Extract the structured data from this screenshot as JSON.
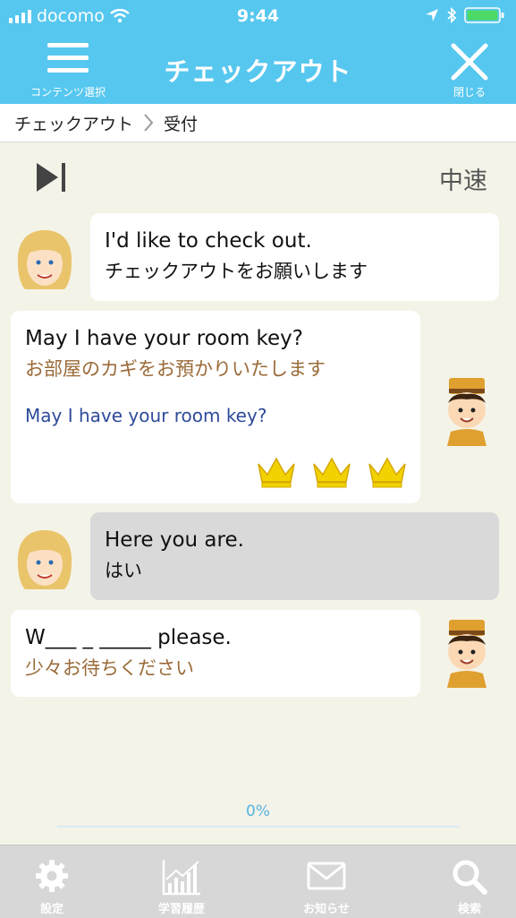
{
  "status": {
    "carrier": "docomo",
    "time": "9:44"
  },
  "header": {
    "menu_label": "コンテンツ選択",
    "title": "チェックアウト",
    "close_label": "閉じる"
  },
  "breadcrumb": {
    "parent": "チェックアウト",
    "current": "受付"
  },
  "controls": {
    "speed": "中速"
  },
  "messages": [
    {
      "speaker": "guest",
      "en": "I'd like to check out.",
      "ja": "チェックアウトをお願いします"
    },
    {
      "speaker": "staff",
      "en": "May I have your room key?",
      "ja": "お部屋のカギをお預かりいたします",
      "answer": "May I have your room key?",
      "crowns": 3
    },
    {
      "speaker": "guest",
      "en": "Here you are.",
      "ja": "はい"
    },
    {
      "speaker": "staff",
      "en": "W___ _ _____ please.",
      "ja": "少々お待ちください"
    }
  ],
  "progress": {
    "label": "0%",
    "value": 0
  },
  "tabs": [
    {
      "label": "設定",
      "icon": "gear-icon"
    },
    {
      "label": "学習履歴",
      "icon": "chart-icon"
    },
    {
      "label": "お知らせ",
      "icon": "mail-icon"
    },
    {
      "label": "検索",
      "icon": "search-icon"
    }
  ],
  "colors": {
    "accent": "#56c7ef",
    "brown_text": "#9a6a38",
    "blue_text": "#2e4a9a",
    "crown": "#f2d200"
  }
}
